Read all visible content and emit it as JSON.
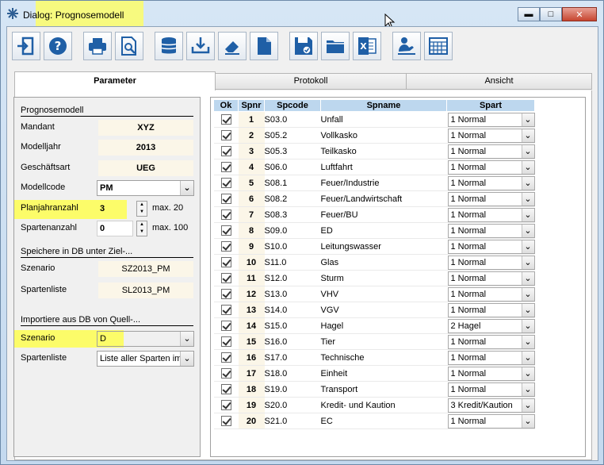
{
  "window": {
    "title": "Dialog: Prognosemodell"
  },
  "toolbar": {
    "buttons": [
      "exit-icon",
      "help-icon",
      "print-icon",
      "print-preview-icon",
      "database-icon",
      "import-icon",
      "eraser-icon",
      "document-icon",
      "save-icon",
      "folder-icon",
      "excel-icon",
      "user-icon",
      "calculator-icon"
    ]
  },
  "tabs": [
    {
      "label": "Parameter",
      "active": true
    },
    {
      "label": "Protokoll",
      "active": false
    },
    {
      "label": "Ansicht",
      "active": false
    }
  ],
  "params": {
    "section1": "Prognosemodell",
    "mandant_label": "Mandant",
    "mandant_value": "XYZ",
    "modelljahr_label": "Modelljahr",
    "modelljahr_value": "2013",
    "geschaeftsart_label": "Geschäftsart",
    "geschaeftsart_value": "UEG",
    "modellcode_label": "Modellcode",
    "modellcode_value": "PM",
    "planjahre_label": "Planjahranzahl",
    "planjahre_value": "3",
    "planjahre_max": "max. 20",
    "sparten_label": "Spartenanzahl",
    "sparten_value": "0",
    "sparten_max": "max. 100",
    "section2": "Speichere in DB unter Ziel-...",
    "ziel_szenario_label": "Szenario",
    "ziel_szenario_value": "SZ2013_PM",
    "ziel_spartenliste_label": "Spartenliste",
    "ziel_spartenliste_value": "SL2013_PM",
    "section3": "Importiere aus DB von Quell-...",
    "quell_szenario_label": "Szenario",
    "quell_szenario_value": "D",
    "quell_spartenliste_label": "Spartenliste",
    "quell_spartenliste_value": "Liste aller Sparten im"
  },
  "grid": {
    "headers": [
      "Ok",
      "Spnr",
      "Spcode",
      "Spname",
      "Spart"
    ],
    "rows": [
      {
        "nr": "1",
        "code": "S03.0",
        "name": "Unfall",
        "spart": "1 Normal"
      },
      {
        "nr": "2",
        "code": "S05.2",
        "name": "Vollkasko",
        "spart": "1 Normal"
      },
      {
        "nr": "3",
        "code": "S05.3",
        "name": "Teilkasko",
        "spart": "1 Normal"
      },
      {
        "nr": "4",
        "code": "S06.0",
        "name": "Luftfahrt",
        "spart": "1 Normal"
      },
      {
        "nr": "5",
        "code": "S08.1",
        "name": "Feuer/Industrie",
        "spart": "1 Normal"
      },
      {
        "nr": "6",
        "code": "S08.2",
        "name": "Feuer/Landwirtschaft",
        "spart": "1 Normal"
      },
      {
        "nr": "7",
        "code": "S08.3",
        "name": "Feuer/BU",
        "spart": "1 Normal"
      },
      {
        "nr": "8",
        "code": "S09.0",
        "name": "ED",
        "spart": "1 Normal"
      },
      {
        "nr": "9",
        "code": "S10.0",
        "name": "Leitungswasser",
        "spart": "1 Normal"
      },
      {
        "nr": "10",
        "code": "S11.0",
        "name": "Glas",
        "spart": "1 Normal"
      },
      {
        "nr": "11",
        "code": "S12.0",
        "name": "Sturm",
        "spart": "1 Normal"
      },
      {
        "nr": "12",
        "code": "S13.0",
        "name": "VHV",
        "spart": "1 Normal"
      },
      {
        "nr": "13",
        "code": "S14.0",
        "name": "VGV",
        "spart": "1 Normal"
      },
      {
        "nr": "14",
        "code": "S15.0",
        "name": "Hagel",
        "spart": "2 Hagel"
      },
      {
        "nr": "15",
        "code": "S16.0",
        "name": "Tier",
        "spart": "1 Normal"
      },
      {
        "nr": "16",
        "code": "S17.0",
        "name": "Technische",
        "spart": "1 Normal"
      },
      {
        "nr": "17",
        "code": "S18.0",
        "name": "Einheit",
        "spart": "1 Normal"
      },
      {
        "nr": "18",
        "code": "S19.0",
        "name": "Transport",
        "spart": "1 Normal"
      },
      {
        "nr": "19",
        "code": "S20.0",
        "name": "Kredit- und Kaution",
        "spart": "3 Kredit/Kaution"
      },
      {
        "nr": "20",
        "code": "S21.0",
        "name": "EC",
        "spart": "1 Normal"
      }
    ]
  },
  "colors": {
    "highlight": "#fdfd5a",
    "header_bg": "#bdd7ee",
    "readonly_bg": "#fbf6e8"
  }
}
